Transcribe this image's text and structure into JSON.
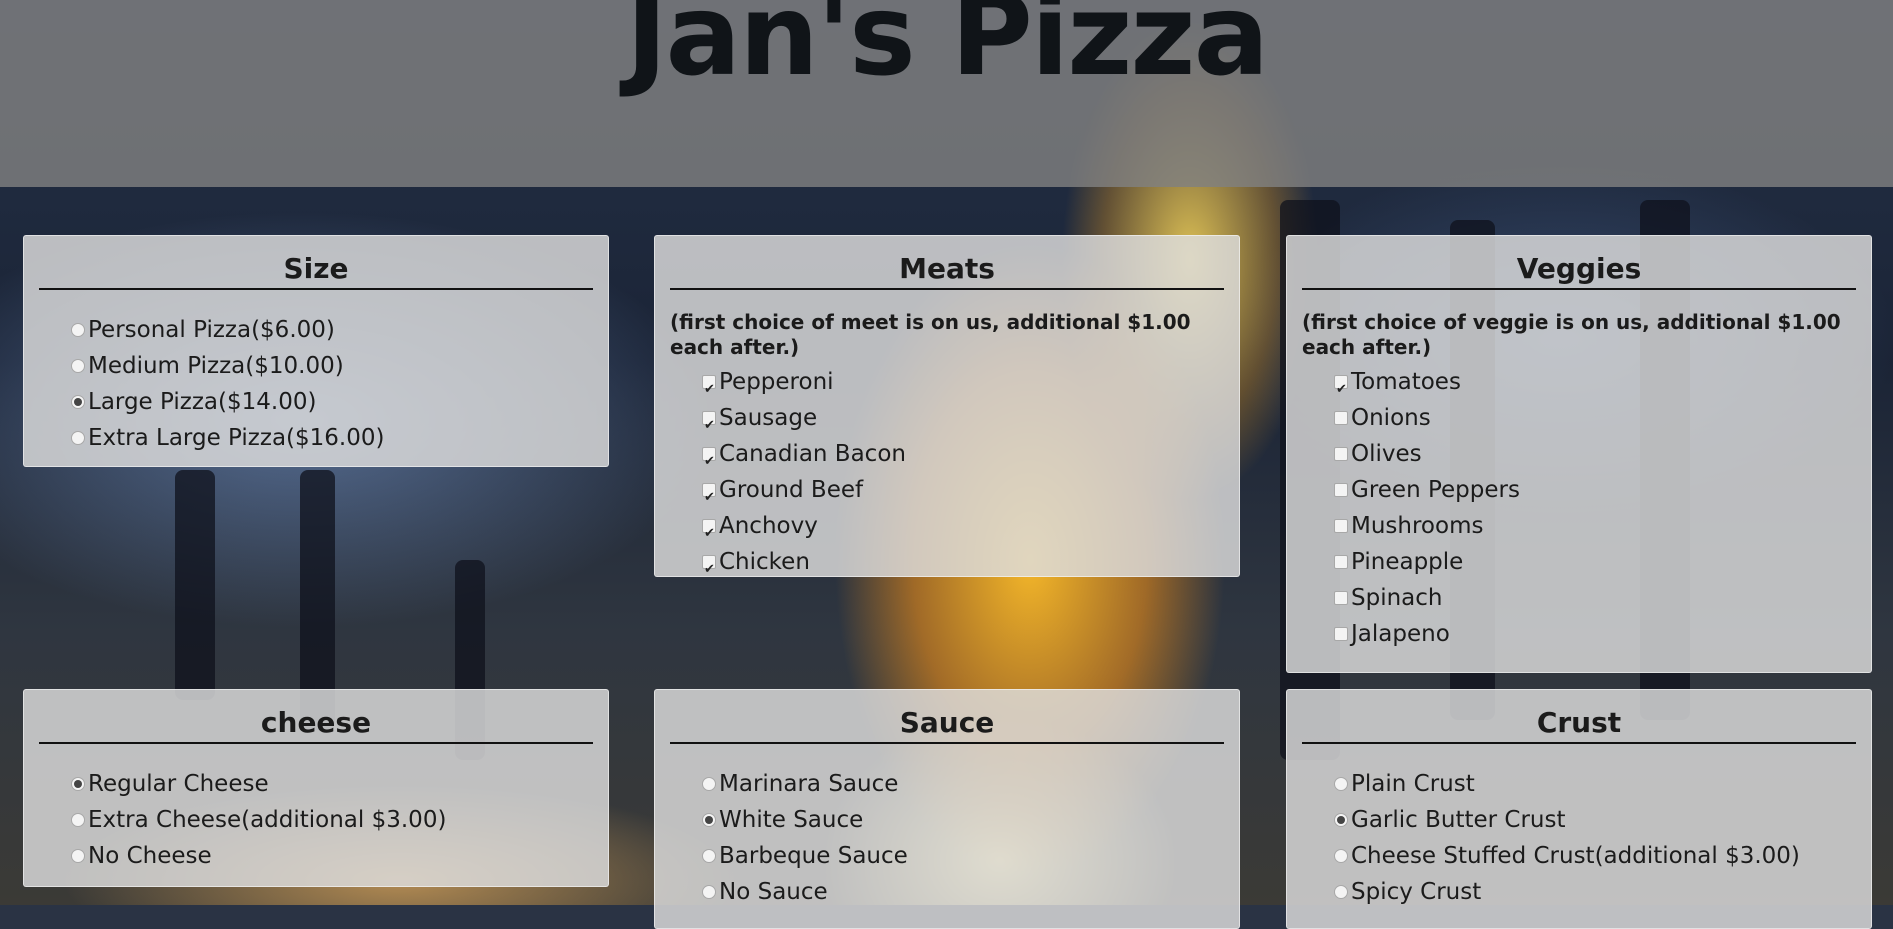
{
  "header": {
    "title": "Jan's Pizza"
  },
  "size": {
    "title": "Size",
    "options": [
      {
        "label": "Personal Pizza($6.00)",
        "selected": false
      },
      {
        "label": "Medium Pizza($10.00)",
        "selected": false
      },
      {
        "label": "Large Pizza($14.00)",
        "selected": true
      },
      {
        "label": "Extra Large Pizza($16.00)",
        "selected": false
      }
    ]
  },
  "meats": {
    "title": "Meats",
    "note": "(first choice of meet is on us, additional $1.00 each after.)",
    "options": [
      {
        "label": "Pepperoni",
        "checked": true
      },
      {
        "label": "Sausage",
        "checked": true
      },
      {
        "label": "Canadian Bacon",
        "checked": true
      },
      {
        "label": "Ground Beef",
        "checked": true
      },
      {
        "label": "Anchovy",
        "checked": true
      },
      {
        "label": "Chicken",
        "checked": true
      }
    ]
  },
  "veggies": {
    "title": "Veggies",
    "note": "(first choice of veggie is on us, additional $1.00 each after.)",
    "options": [
      {
        "label": "Tomatoes",
        "checked": true
      },
      {
        "label": "Onions",
        "checked": false
      },
      {
        "label": "Olives",
        "checked": false
      },
      {
        "label": "Green Peppers",
        "checked": false
      },
      {
        "label": "Mushrooms",
        "checked": false
      },
      {
        "label": "Pineapple",
        "checked": false
      },
      {
        "label": "Spinach",
        "checked": false
      },
      {
        "label": "Jalapeno",
        "checked": false
      }
    ]
  },
  "cheese": {
    "title": "cheese",
    "options": [
      {
        "label": "Regular Cheese",
        "selected": true
      },
      {
        "label": "Extra Cheese(additional $3.00)",
        "selected": false
      },
      {
        "label": "No Cheese",
        "selected": false
      }
    ]
  },
  "sauce": {
    "title": "Sauce",
    "options": [
      {
        "label": "Marinara Sauce",
        "selected": false
      },
      {
        "label": "White Sauce",
        "selected": true
      },
      {
        "label": "Barbeque Sauce",
        "selected": false
      },
      {
        "label": "No Sauce",
        "selected": false
      }
    ]
  },
  "crust": {
    "title": "Crust",
    "options": [
      {
        "label": "Plain Crust",
        "selected": false
      },
      {
        "label": "Garlic Butter Crust",
        "selected": true
      },
      {
        "label": "Cheese Stuffed Crust(additional $3.00)",
        "selected": false
      },
      {
        "label": "Spicy Crust",
        "selected": false
      }
    ]
  }
}
